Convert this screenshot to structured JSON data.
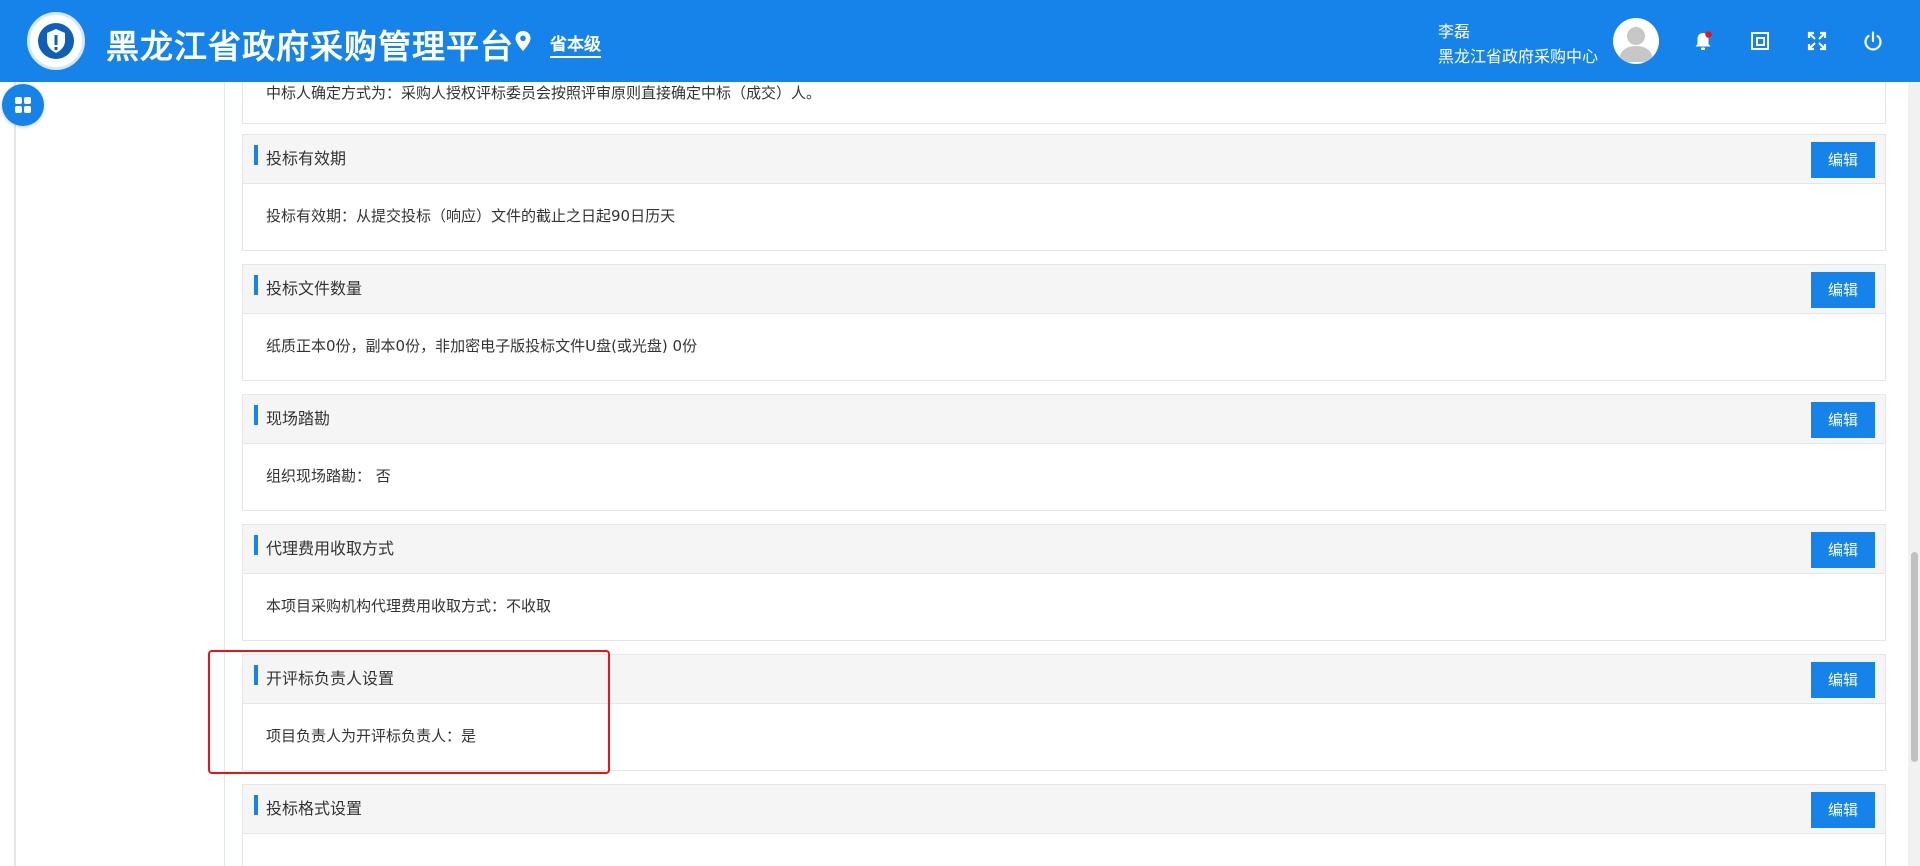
{
  "header": {
    "app_title": "黑龙江省政府采购管理平台",
    "level": "省本级",
    "user_name": "李磊",
    "user_org": "黑龙江省政府采购中心",
    "icons": [
      "location-icon",
      "notification-bell-icon",
      "window-icon",
      "fullscreen-icon",
      "power-icon"
    ],
    "notification_dot_color": "#e8141b"
  },
  "content": {
    "top_fragment_text": "中标人确定方式为：采购人授权评标委员会按照评审原则直接确定中标（成交）人。",
    "edit_label": "编辑",
    "sections": [
      {
        "title": "投标有效期",
        "body": "投标有效期：从提交投标（响应）文件的截止之日起90日历天"
      },
      {
        "title": "投标文件数量",
        "body": "纸质正本0份，副本0份，非加密电子版投标文件U盘(或光盘) 0份"
      },
      {
        "title": "现场踏勘",
        "body": "组织现场踏勘： 否"
      },
      {
        "title": "代理费用收取方式",
        "body": "本项目采购机构代理费用收取方式：不收取"
      },
      {
        "title": "开评标负责人设置",
        "body": "项目负责人为开评标负责人：是"
      },
      {
        "title": "投标格式设置",
        "body": ""
      }
    ]
  },
  "colors": {
    "primary": "#1583e9",
    "highlight": "#e8141b"
  }
}
